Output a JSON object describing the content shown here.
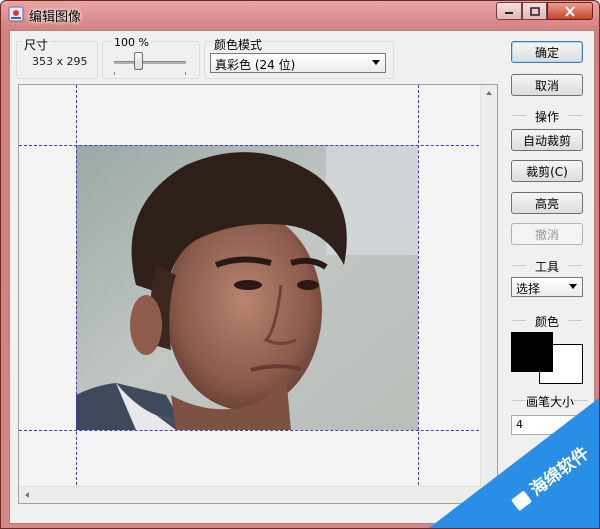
{
  "window": {
    "title": "编辑图像"
  },
  "toolbar": {
    "size_label": "尺寸",
    "size_value": "353 x 295",
    "zoom_label": "100 %",
    "zoom_fraction": 0.33,
    "color_mode_label": "颜色模式",
    "color_mode_value": "真彩色 (24 位)"
  },
  "buttons": {
    "ok": "确定",
    "cancel": "取消",
    "auto_crop": "自动裁剪",
    "crop": "裁剪(C)",
    "highlight": "高亮",
    "undo": "撤消"
  },
  "sections": {
    "operations": "操作",
    "tools": "工具",
    "color": "颜色",
    "brush_size": "画笔大小"
  },
  "tool_select": {
    "value": "选择"
  },
  "brush_size_value": "4",
  "colors": {
    "primary": "#000000",
    "secondary": "#ffffff",
    "guide": "#3b3bc8",
    "titlebar": "#d48686"
  },
  "watermark": {
    "text": "海绵软件"
  }
}
